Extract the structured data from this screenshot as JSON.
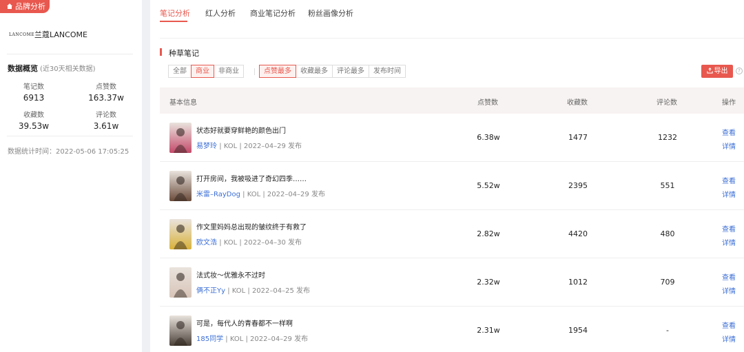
{
  "sidebar": {
    "brand_tag": "品牌分析",
    "brand_logo": "LANCOME",
    "brand_name": "兰蔻LANCOME",
    "overview_title": "数据概览",
    "overview_note": "(近30天相关数据)",
    "stats": [
      {
        "label": "笔记数",
        "value": "6913"
      },
      {
        "label": "点赞数",
        "value": "163.37w"
      },
      {
        "label": "收藏数",
        "value": "39.53w"
      },
      {
        "label": "评论数",
        "value": "3.61w"
      }
    ],
    "stat_time": "数据统计时间：2022-05-06 17:05:25"
  },
  "tabs": [
    "笔记分析",
    "红人分析",
    "商业笔记分析",
    "粉丝画像分析"
  ],
  "section_title": "种草笔记",
  "filters": {
    "type": [
      "全部",
      "商业",
      "非商业"
    ],
    "type_active": 1,
    "sort": [
      "点赞最多",
      "收藏最多",
      "评论最多",
      "发布时间"
    ],
    "sort_active": 0
  },
  "export_label": "导出",
  "help_label": "?",
  "table": {
    "headers": [
      "基本信息",
      "点赞数",
      "收藏数",
      "评论数",
      "操作"
    ],
    "action_view": "查看",
    "action_detail": "详情",
    "rows": [
      {
        "title": "状态好就要穿鲜艳的颜色出门",
        "author": "易梦玲",
        "meta": "| KOL | 2022–04–29 发布",
        "likes": "6.38w",
        "favs": "1477",
        "comments": "1232",
        "thumb_color": "#c44a6a"
      },
      {
        "title": "打开房间，我被吸进了奇幻四季……",
        "author": "米雷–RayDog",
        "meta": "| KOL | 2022–04–29 发布",
        "likes": "5.52w",
        "favs": "2395",
        "comments": "551",
        "thumb_color": "#6a4a3a"
      },
      {
        "title": "作文里妈妈总出现的皱纹终于有救了",
        "author": "欧文浩",
        "meta": "| KOL | 2022–04–30 发布",
        "likes": "2.82w",
        "favs": "4420",
        "comments": "480",
        "thumb_color": "#d9b23a"
      },
      {
        "title": "法式妆～优雅永不过时",
        "author": "俩不正Yy",
        "meta": "| KOL | 2022–04–25 发布",
        "likes": "2.32w",
        "favs": "1012",
        "comments": "709",
        "thumb_color": "#d8c4b8"
      },
      {
        "title": "可是，每代人的青春都不一样啊",
        "author": "185同学",
        "meta": "| KOL | 2022–04–29 发布",
        "likes": "2.31w",
        "favs": "1954",
        "comments": "-",
        "thumb_color": "#4a4038"
      }
    ]
  }
}
